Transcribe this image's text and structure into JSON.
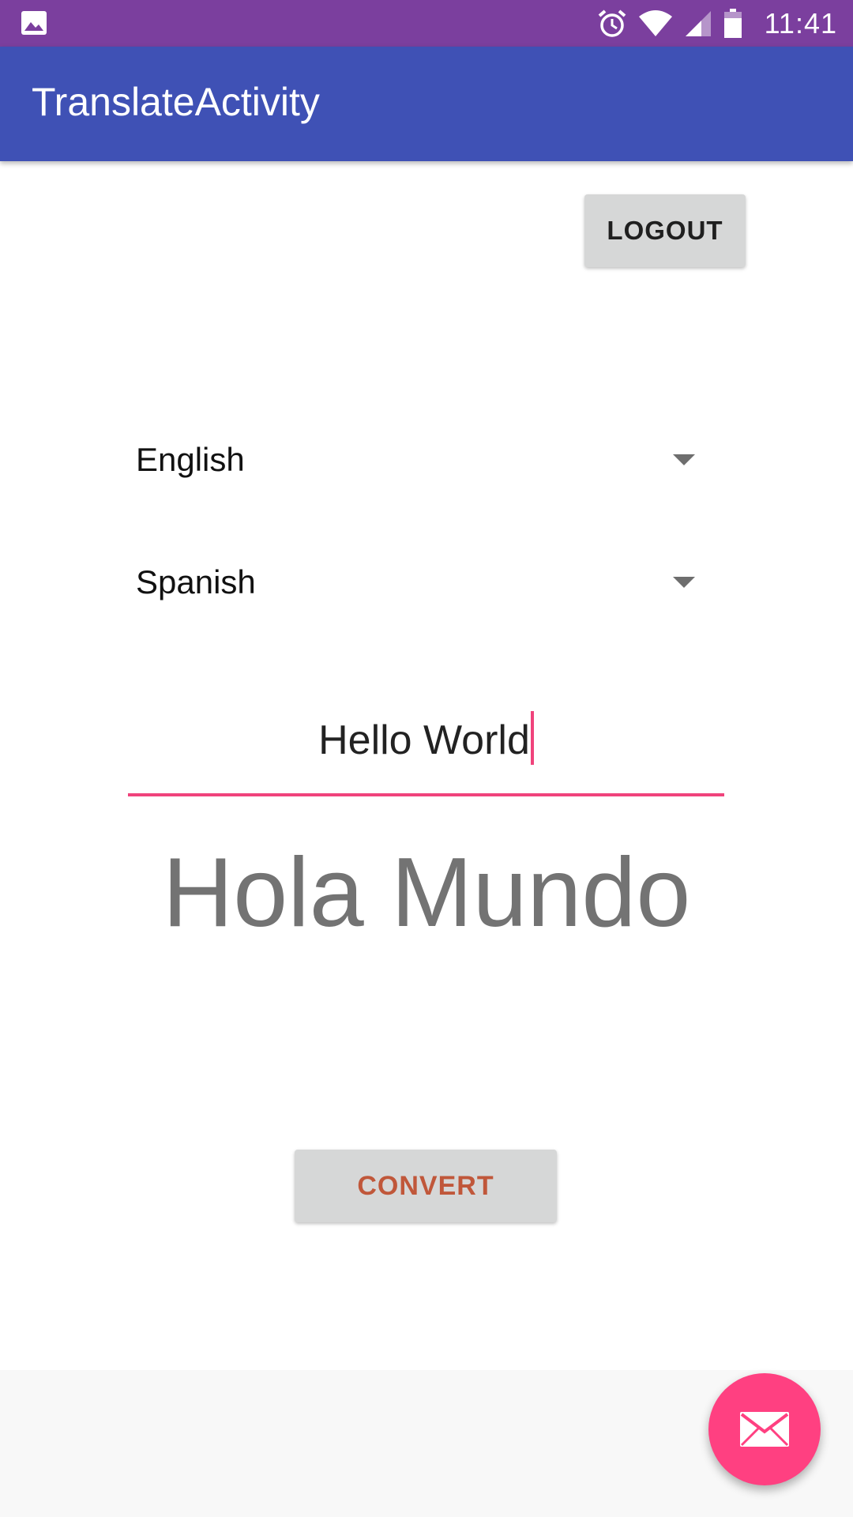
{
  "status_bar": {
    "time": "11:41",
    "icons": [
      "image-notification-icon",
      "alarm-icon",
      "wifi-icon",
      "cell-signal-icon",
      "battery-icon"
    ],
    "color": "#7b3f9e"
  },
  "app_bar": {
    "title": "TranslateActivity",
    "color": "#3f51b5"
  },
  "logout_button": {
    "label": "LOGOUT"
  },
  "source_language": {
    "selected": "English"
  },
  "target_language": {
    "selected": "Spanish"
  },
  "input": {
    "value": "Hello World",
    "accent_color": "#f0437c"
  },
  "result": {
    "text": "Hola Mundo"
  },
  "convert_button": {
    "label": "CONVERT",
    "text_color": "#c0573a"
  },
  "fab": {
    "icon": "mail-icon",
    "color": "#ff4081"
  }
}
